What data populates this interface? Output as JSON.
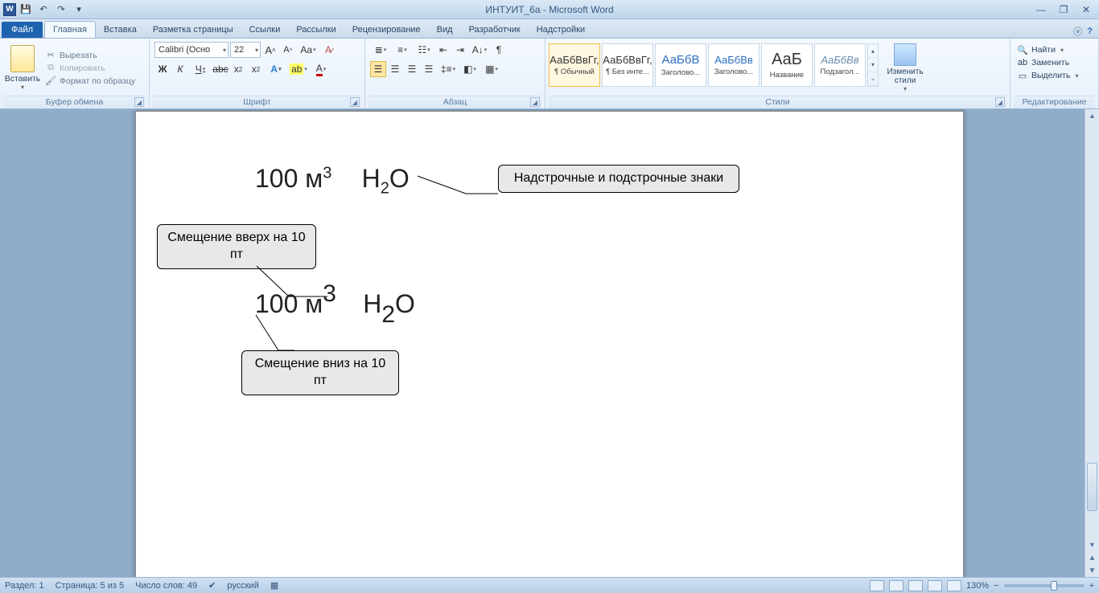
{
  "title": "ИНТУИТ_6a  -  Microsoft Word",
  "qat": {
    "save": "💾",
    "undo": "↶",
    "redo": "↷"
  },
  "tabs": {
    "file": "Файл",
    "items": [
      "Главная",
      "Вставка",
      "Разметка страницы",
      "Ссылки",
      "Рассылки",
      "Рецензирование",
      "Вид",
      "Разработчик",
      "Надстройки"
    ],
    "active_index": 0
  },
  "ribbon": {
    "clipboard": {
      "label": "Буфер обмена",
      "paste": "Вставить",
      "cut": "Вырезать",
      "copy": "Копировать",
      "format_painter": "Формат по образцу"
    },
    "font": {
      "label": "Шрифт",
      "name": "Calibri (Осно",
      "size": "22",
      "grow": "A▲",
      "shrink": "A▼"
    },
    "paragraph": {
      "label": "Абзац"
    },
    "styles": {
      "label": "Стили",
      "items": [
        {
          "sample": "АаБбВвГг,",
          "name": "¶ Обычный"
        },
        {
          "sample": "АаБбВвГг,",
          "name": "¶ Без инте..."
        },
        {
          "sample": "АаБбВ",
          "name": "Заголово..."
        },
        {
          "sample": "АаБбВв",
          "name": "Заголово..."
        },
        {
          "sample": "АаБ",
          "name": "Название"
        },
        {
          "sample": "АаБбВв",
          "name": "Подзагол..."
        }
      ],
      "change": "Изменить стили"
    },
    "editing": {
      "label": "Редактирование",
      "find": "Найти",
      "replace": "Заменить",
      "select": "Выделить"
    }
  },
  "document": {
    "line1_a": "100 м",
    "line1_a_sup": "3",
    "line1_b_h": "H",
    "line1_b_sub": "2",
    "line1_b_o": "O",
    "callout1": "Надстрочные и подстрочные знаки",
    "callout2": "Смещение вверх на 10 пт",
    "line2_a": "100 м",
    "line2_a_sup": "3",
    "line2_b_h": "H",
    "line2_b_sub": "2",
    "line2_b_o": "O",
    "callout3": "Смещение вниз на 10 пт"
  },
  "status": {
    "section": "Раздел: 1",
    "page": "Страница: 5 из 5",
    "words": "Число слов: 49",
    "lang": "русский",
    "zoom": "130%"
  }
}
